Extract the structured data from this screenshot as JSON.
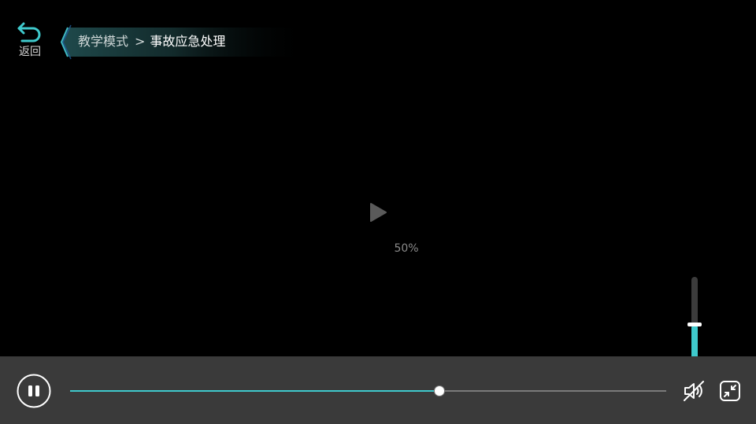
{
  "header": {
    "back_label": "返回",
    "back_icon": "undo-arrow-icon",
    "breadcrumb": {
      "parent": "教学模式",
      "separator": ">",
      "current": "事故应急处理"
    }
  },
  "player": {
    "center_icon": "play-icon",
    "loading_percent": "50%",
    "progress": 0.62,
    "volume": 0.5
  },
  "controls": {
    "pause_icon": "pause-icon",
    "mute_icon": "volume-muted-icon",
    "exit_fullscreen_icon": "exit-fullscreen-icon"
  },
  "colors": {
    "accent": "#3fc9cc",
    "bar": "#3a3a3a",
    "background": "#000000"
  }
}
